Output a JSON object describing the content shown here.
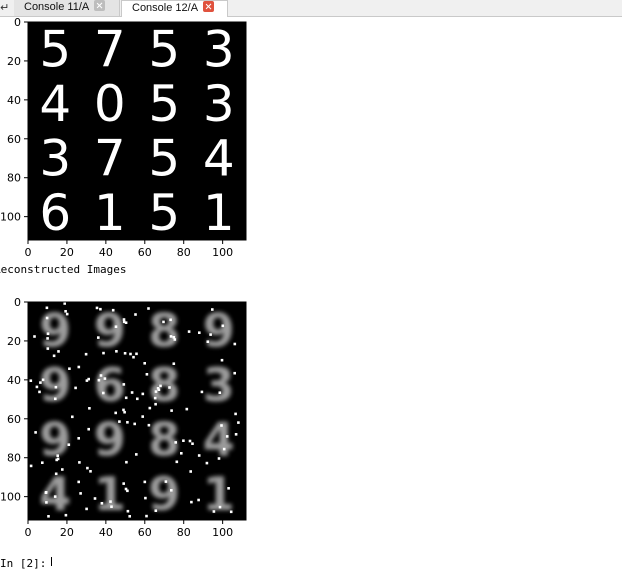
{
  "tabs": {
    "prev_arrow": "↵",
    "items": [
      {
        "label": "Console 11/A",
        "active": false
      },
      {
        "label": "Console 12/A",
        "active": true
      }
    ],
    "close_color_active": "#e0523e",
    "close_color_inactive": "#bdbdbd"
  },
  "console": {
    "reconstructed_label": "Reconstructed Images",
    "prompt_label": "In [2]:"
  },
  "figures": {
    "original": {
      "xticks": [
        "0",
        "20",
        "40",
        "60",
        "80",
        "100"
      ],
      "yticks": [
        "0",
        "20",
        "40",
        "60",
        "80",
        "100"
      ]
    },
    "reconstructed": {
      "xticks": [
        "0",
        "20",
        "40",
        "60",
        "80",
        "100"
      ],
      "yticks": [
        "0",
        "20",
        "40",
        "60",
        "80",
        "100"
      ]
    }
  },
  "chart_data": [
    {
      "type": "image-grid",
      "grid": [
        4,
        4
      ],
      "digits": [
        [
          "5",
          "7",
          "5",
          "3"
        ],
        [
          "4",
          "0",
          "5",
          "3"
        ],
        [
          "3",
          "7",
          "5",
          "4"
        ],
        [
          "6",
          "1",
          "5",
          "1"
        ]
      ],
      "xlim": [
        0,
        112
      ],
      "ylim": [
        112,
        0
      ],
      "xticks": [
        0,
        20,
        40,
        60,
        80,
        100
      ],
      "yticks": [
        0,
        20,
        40,
        60,
        80,
        100
      ]
    },
    {
      "type": "image-grid",
      "grid": [
        4,
        4
      ],
      "digits": [
        [
          "9",
          "9",
          "8",
          "9"
        ],
        [
          "9",
          "6",
          "8",
          "3"
        ],
        [
          "9",
          "9",
          "8",
          "4"
        ],
        [
          "4",
          "1",
          "9",
          "1"
        ]
      ],
      "xlim": [
        0,
        112
      ],
      "ylim": [
        112,
        0
      ],
      "xticks": [
        0,
        20,
        40,
        60,
        80,
        100
      ],
      "yticks": [
        0,
        20,
        40,
        60,
        80,
        100
      ]
    }
  ]
}
